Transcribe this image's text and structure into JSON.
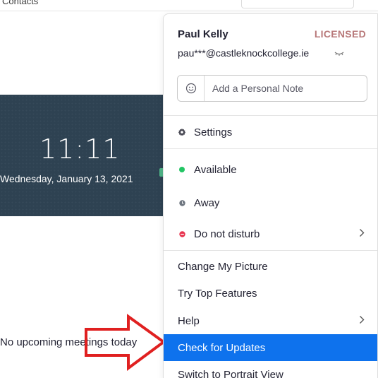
{
  "background": {
    "contacts_label": "Contacts",
    "clock": {
      "time": "11:11",
      "date": "Wednesday, January 13, 2021"
    },
    "no_meetings_text": "No upcoming meetings today"
  },
  "profile_menu": {
    "user_name": "Paul Kelly",
    "license_badge": "LICENSED",
    "email": "pau***@castleknockcollege.ie",
    "note_placeholder": "Add a Personal Note",
    "items": {
      "settings": "Settings",
      "available": "Available",
      "away": "Away",
      "do_not_disturb": "Do not disturb",
      "change_picture": "Change My Picture",
      "top_features": "Try Top Features",
      "help": "Help",
      "check_updates": "Check for Updates",
      "portrait_view": "Switch to Portrait View"
    },
    "colors": {
      "selected_bg": "#0e72ed",
      "available": "#23c564",
      "away": "#6e7680",
      "do_not_disturb": "#e8344e",
      "license": "#b8797a"
    }
  },
  "annotation": {
    "arrow_color": "#e02020"
  }
}
